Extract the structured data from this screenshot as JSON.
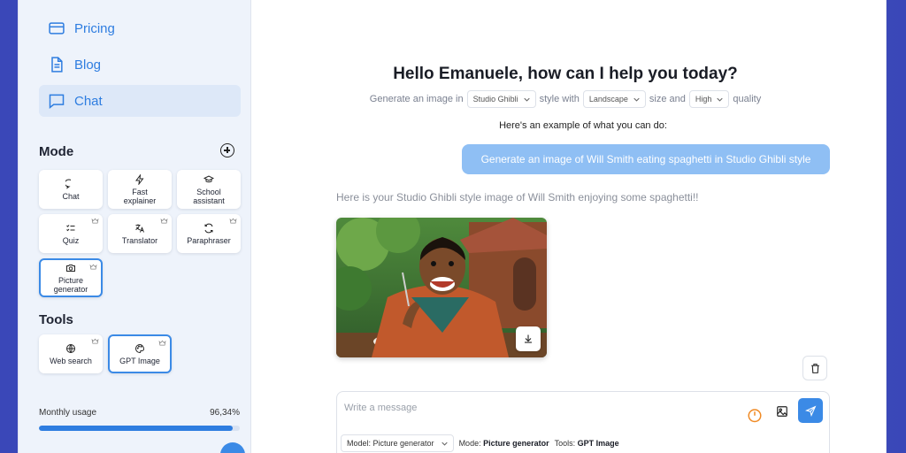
{
  "sidebar": {
    "nav": [
      {
        "label": "Pricing",
        "icon": "credit-card-icon"
      },
      {
        "label": "Blog",
        "icon": "document-icon"
      },
      {
        "label": "Chat",
        "icon": "chat-icon",
        "active": true
      }
    ],
    "mode_title": "Mode",
    "modes": [
      {
        "label": "Chat",
        "icon": "chat-bubble-icon",
        "premium": false
      },
      {
        "label": "Fast explainer",
        "icon": "lightning-icon",
        "premium": false
      },
      {
        "label": "School assistant",
        "icon": "graduation-cap-icon",
        "premium": false
      },
      {
        "label": "Quiz",
        "icon": "checklist-icon",
        "premium": true
      },
      {
        "label": "Translator",
        "icon": "translate-icon",
        "premium": true
      },
      {
        "label": "Paraphraser",
        "icon": "refresh-icon",
        "premium": true
      },
      {
        "label": "Picture generator",
        "icon": "camera-icon",
        "premium": true,
        "selected": true
      }
    ],
    "tools_title": "Tools",
    "tools": [
      {
        "label": "Web search",
        "icon": "globe-icon",
        "premium": true
      },
      {
        "label": "GPT Image",
        "icon": "palette-icon",
        "premium": true,
        "selected": true
      }
    ],
    "usage": {
      "label": "Monthly usage",
      "value": "96,34%",
      "fraction": 0.9634
    }
  },
  "main": {
    "greeting": "Hello Emanuele, how can I help you today?",
    "gen": {
      "prefix": "Generate an image in",
      "style": "Studio Ghibli",
      "style_suffix": "style with",
      "size": "Landscape",
      "size_suffix": "size and",
      "quality": "High",
      "quality_suffix": "quality"
    },
    "example_intro": "Here's an example of what you can do:",
    "user_message": "Generate an image of Will Smith eating spaghetti in Studio Ghibli style",
    "reply": "Here is your Studio Ghibli style image of Will Smith enjoying some spaghetti!!",
    "composer": {
      "placeholder": "Write a message",
      "model_label": "Model: Picture generator",
      "mode_prefix": "Mode:",
      "mode_value": "Picture generator",
      "tools_prefix": "Tools:",
      "tools_value": "GPT Image"
    }
  },
  "colors": {
    "accent": "#2e7de0",
    "bubble": "#8fbff4",
    "power": "#f08a24"
  }
}
